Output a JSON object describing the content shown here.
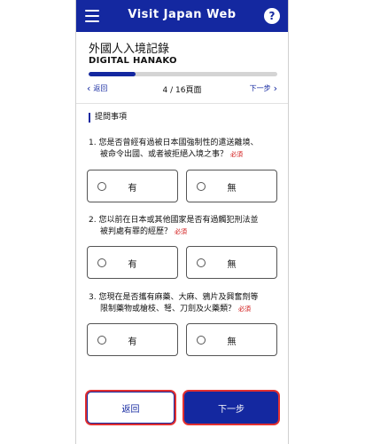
{
  "appbar": {
    "title": "Visit Japan Web",
    "menu_icon": "hamburger-menu-icon",
    "help_icon": "help-icon",
    "help_glyph": "?"
  },
  "form": {
    "title": "外國人入境記錄",
    "name": "DIGITAL HANAKO"
  },
  "progress": {
    "current": 4,
    "total": 16,
    "fraction": 0.25
  },
  "pager": {
    "back_label": "返回",
    "page_label": "4 / 16頁面",
    "next_label": "下一步"
  },
  "section": {
    "title": "提問事項"
  },
  "questions": [
    {
      "line1": "1. 您是否曾經有過被日本國強制性的遣送離境、",
      "line2": "被命令出國、或者被拒絕入境之事？",
      "required": "必須",
      "yes": "有",
      "no": "無"
    },
    {
      "line1": "2. 您以前在日本或其他國家是否有過觸犯刑法並",
      "line2": "被判處有罪的經歷？",
      "required": "必須",
      "yes": "有",
      "no": "無"
    },
    {
      "line1": "3. 您現在是否攜有麻藥、大麻、鴉片及興奮劑等",
      "line2": "限制藥物或槍枝、弩、刀劍及火藥類？",
      "required": "必須",
      "yes": "有",
      "no": "無"
    }
  ],
  "footer": {
    "back_label": "返回",
    "next_label": "下一步"
  },
  "colors": {
    "brand": "#1428a0",
    "required": "#d01010",
    "highlight": "#e23030"
  }
}
